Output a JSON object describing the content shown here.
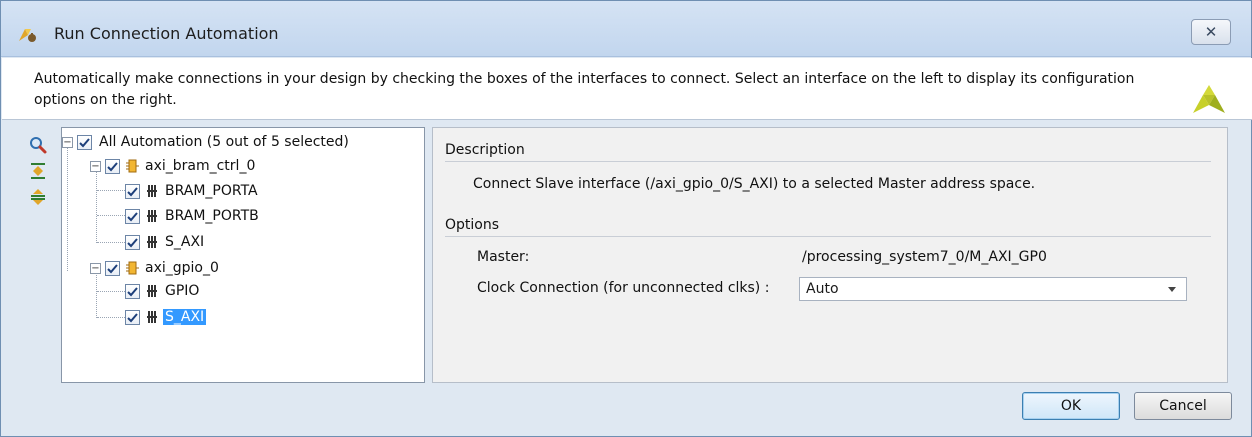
{
  "window": {
    "title": "Run Connection Automation",
    "close_glyph": "✕"
  },
  "banner": {
    "text": "Automatically make connections in your design by checking the boxes of the interfaces to connect. Select an interface on the left to display its configuration options on the right."
  },
  "toolbar": {
    "icons": [
      "search-icon",
      "expand-all-icon",
      "collapse-all-icon"
    ]
  },
  "tree": {
    "root": {
      "label": "All Automation (5 out of 5 selected)",
      "checked": true,
      "expanded": true
    },
    "groups": [
      {
        "label": "axi_bram_ctrl_0",
        "checked": true,
        "expanded": true,
        "children": [
          {
            "label": "BRAM_PORTA",
            "checked": true
          },
          {
            "label": "BRAM_PORTB",
            "checked": true
          },
          {
            "label": "S_AXI",
            "checked": true
          }
        ]
      },
      {
        "label": "axi_gpio_0",
        "checked": true,
        "expanded": true,
        "children": [
          {
            "label": "GPIO",
            "checked": true
          },
          {
            "label": "S_AXI",
            "checked": true,
            "selected": true
          }
        ]
      }
    ]
  },
  "details": {
    "description_title": "Description",
    "description_text": "Connect Slave interface (/axi_gpio_0/S_AXI) to a selected Master address space.",
    "options_title": "Options",
    "master_label": "Master:",
    "master_value": "/processing_system7_0/M_AXI_GP0",
    "clock_label": "Clock Connection (for unconnected clks) :",
    "clock_value": "Auto"
  },
  "buttons": {
    "ok": "OK",
    "cancel": "Cancel"
  },
  "colors": {
    "selection": "#3399ff",
    "titlebar": "#c8daf0",
    "logo": "#c7d02a"
  }
}
